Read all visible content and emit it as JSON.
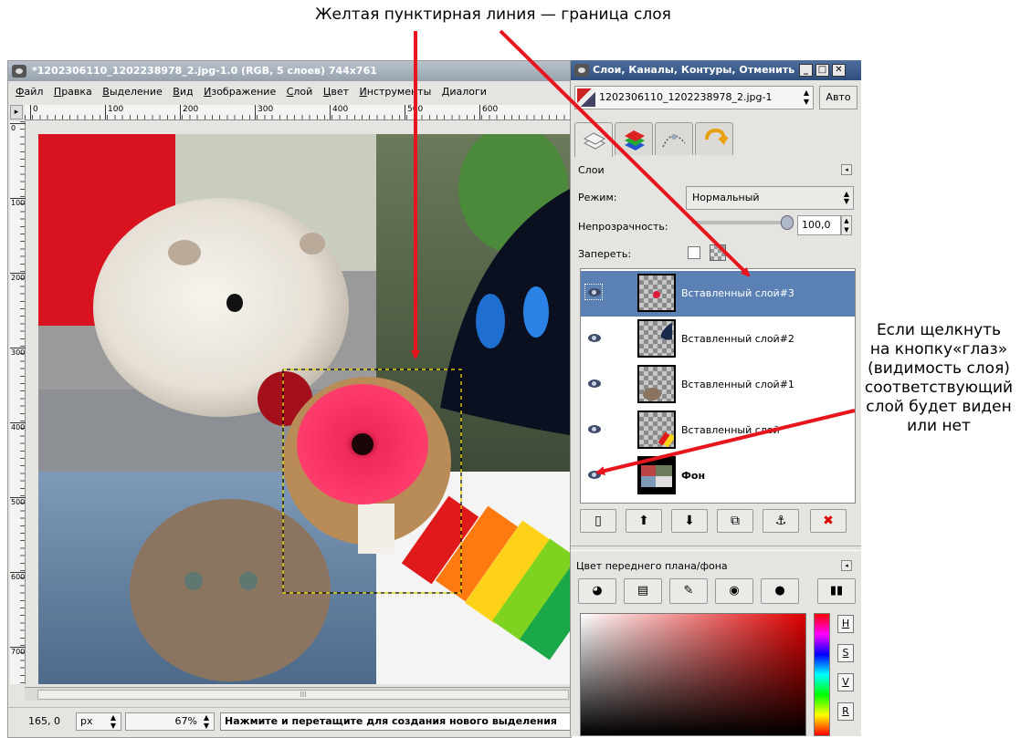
{
  "annotations": {
    "top": "Желтая пунктирная линия — граница слоя",
    "right_lines": [
      "Если щелкнуть",
      "на кнопку«глаз»",
      "(видимость слоя)",
      "соответствующий",
      "слой будет виден",
      "или нет"
    ]
  },
  "image_window": {
    "title": "*1202306110_1202238978_2.jpg-1.0 (RGB, 5 слоев) 744x761",
    "menu": [
      "Файл",
      "Правка",
      "Выделение",
      "Вид",
      "Изображение",
      "Слой",
      "Цвет",
      "Инструменты",
      "Диалоги"
    ],
    "ruler_h": [
      "0",
      "100",
      "200",
      "300",
      "400",
      "500",
      "600"
    ],
    "ruler_v": [
      "0",
      "100",
      "200",
      "300",
      "400",
      "500",
      "600",
      "700"
    ],
    "status": {
      "coords": "165, 0",
      "unit": "px",
      "zoom": "67%",
      "message": "Нажмите и перетащите для создания нового выделения"
    }
  },
  "layers_dialog": {
    "title": "Слои, Каналы, Контуры, Отменить",
    "image_selector": "1202306110_1202238978_2.jpg-1",
    "auto_button": "Авто",
    "panel_title": "Слои",
    "mode_label": "Режим:",
    "mode_value": "Нормальный",
    "opacity_label": "Непрозрачность:",
    "opacity_value": "100,0",
    "opacity_level": 1.0,
    "lock_label": "Запереть:",
    "layers": [
      {
        "name": "Вставленный слой#3",
        "selected": true,
        "visible": true
      },
      {
        "name": "Вставленный слой#2",
        "selected": false,
        "visible": true
      },
      {
        "name": "Вставленный слой#1",
        "selected": false,
        "visible": true
      },
      {
        "name": "Вставленный слой",
        "selected": false,
        "visible": true
      },
      {
        "name": "Фон",
        "selected": false,
        "visible": true
      }
    ],
    "layer_buttons": [
      "new-layer-icon",
      "raise-layer-icon",
      "lower-layer-icon",
      "duplicate-layer-icon",
      "anchor-icon",
      "delete-layer-icon"
    ],
    "fg_title": "Цвет переднего плана/фона",
    "color_mode_buttons": [
      "H",
      "S",
      "V",
      "R"
    ]
  },
  "colors": {
    "selected_row": "#5a80b4",
    "dialog_title": "#2e4f7e",
    "arrow": "#e8141e",
    "selection_border": "#ffeb00"
  }
}
